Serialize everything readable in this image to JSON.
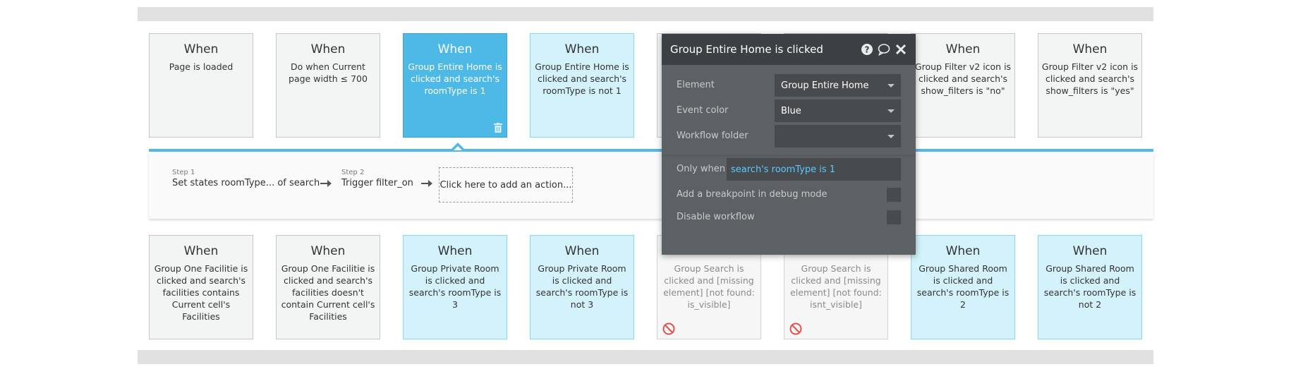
{
  "top_events": [
    {
      "when": "When",
      "condition": "Page is loaded",
      "style": "gray"
    },
    {
      "when": "When",
      "condition": "Do when Current page width ≤ 700",
      "style": "gray"
    },
    {
      "when": "When",
      "condition": "Group Entire Home is clicked and search's roomType is 1",
      "style": "selected"
    },
    {
      "when": "When",
      "condition": "Group Entire Home is clicked and search's roomType is not 1",
      "style": "light"
    },
    {
      "when": "When",
      "condition": "Group Filter v2 icon is clicked and search's show_filters is \"no\"",
      "style": "gray"
    },
    {
      "when": "When",
      "condition": "Group Filter v2 icon is clicked and search's show_filters is \"yes\"",
      "style": "gray"
    }
  ],
  "bottom_events": [
    {
      "when": "When",
      "condition": "Group One Facilitie is clicked and search's facilities contains Current cell's Facilities",
      "style": "gray"
    },
    {
      "when": "When",
      "condition": "Group One Facilitie is clicked and search's facilities doesn't contain Current cell's Facilities",
      "style": "gray"
    },
    {
      "when": "When",
      "condition": "Group Private Room is clicked and search's roomType is 3",
      "style": "light"
    },
    {
      "when": "When",
      "condition": "Group Private Room is clicked and search's roomType is not 3",
      "style": "light"
    },
    {
      "when": "",
      "condition": "Group Search is clicked and [missing element] [not found: is_visible]",
      "style": "disabled"
    },
    {
      "when": "",
      "condition": "Group Search is clicked and [missing element] [not found: isnt_visible]",
      "style": "disabled"
    },
    {
      "when": "When",
      "condition": "Group Shared Room is clicked and search's roomType is 2",
      "style": "light"
    },
    {
      "when": "When",
      "condition": "Group Shared Room is clicked and search's roomType is not 2",
      "style": "light"
    }
  ],
  "workflow": {
    "steps": [
      {
        "num": "Step 1",
        "label": "Set states roomType... of search"
      },
      {
        "num": "Step 2",
        "label": "Trigger filter_on"
      }
    ],
    "add_action": "Click here to add an action..."
  },
  "panel": {
    "title": "Group Entire Home is clicked",
    "element_label": "Element",
    "element_value": "Group Entire Home",
    "color_label": "Event color",
    "color_value": "Blue",
    "folder_label": "Workflow folder",
    "folder_value": "",
    "only_when_label": "Only when",
    "only_when_value": "search's roomType is 1",
    "breakpoint_label": "Add a breakpoint in debug mode",
    "disable_label": "Disable workflow"
  },
  "colors": {
    "selected_event": "#4db9e6",
    "light_event": "#d3f2fc",
    "workflow_line": "#54b8e3",
    "expression_text": "#5cc8ff"
  },
  "icons": {
    "help": "help-icon",
    "comment": "comment-icon",
    "close": "close-icon",
    "trash": "trash-icon",
    "disabled": "no-entry-icon",
    "arrow": "arrow-right-icon"
  }
}
